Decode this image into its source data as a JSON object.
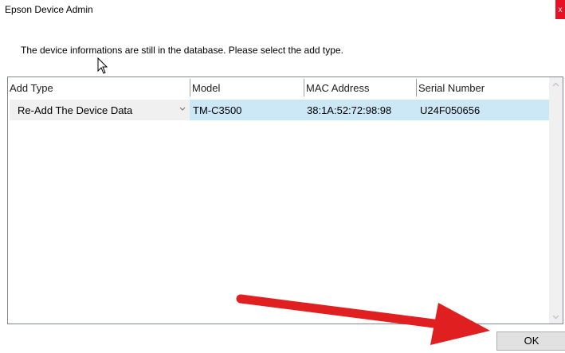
{
  "window": {
    "title": "Epson Device Admin",
    "close_glyph": "x"
  },
  "message": "The device informations are still in the database. Please select the add type.",
  "table": {
    "columns": [
      "Add Type",
      "Model",
      "MAC Address",
      "Serial Number"
    ],
    "rows": [
      {
        "add_type": "Re-Add The Device Data",
        "model": "TM-C3500",
        "mac": "38:1A:52:72:98:98",
        "serial": "U24F050656"
      }
    ]
  },
  "ok_label": "OK",
  "colors": {
    "selection": "#cce8f7",
    "close_button": "#e81123",
    "annotation_arrow": "#e02020"
  },
  "icons": [
    "close-icon",
    "cursor-icon",
    "dropdown-arrow-icon",
    "scroll-up-icon",
    "scroll-down-icon",
    "annotation-arrow-icon"
  ]
}
